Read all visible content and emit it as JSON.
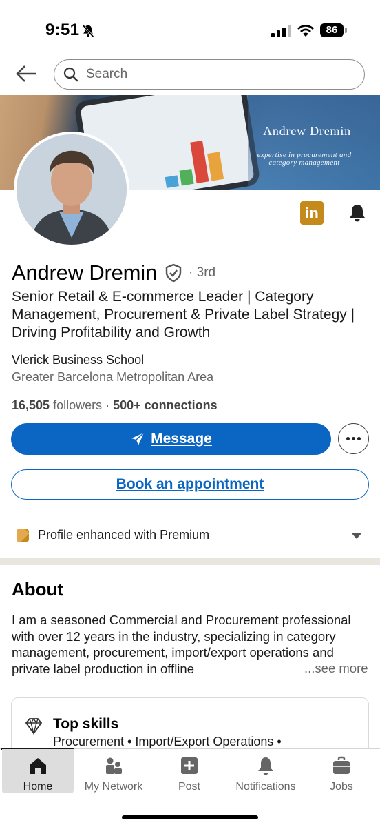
{
  "status_bar": {
    "time": "9:51",
    "battery": "86"
  },
  "search": {
    "placeholder": "Search"
  },
  "banner": {
    "name": "Andrew Dremin",
    "tagline_line1": "expertise in procurement and",
    "tagline_line2": "category management"
  },
  "profile": {
    "name": "Andrew Dremin",
    "degree": "· 3rd",
    "headline": "Senior Retail & E-commerce Leader | Category Management, Procurement & Private Label Strategy |  Driving Profitability and Growth",
    "school": "Vlerick Business School",
    "location": "Greater Barcelona Metropolitan Area",
    "followers_count": "16,505",
    "followers_label": " followers · ",
    "connections": "500+ connections"
  },
  "actions": {
    "message_label": "Message",
    "appointment_label": "Book an appointment",
    "linkedin_badge": "in"
  },
  "premium": {
    "label": "Profile enhanced with Premium"
  },
  "about": {
    "heading": "About",
    "text": "I am a seasoned Commercial and Procurement professional with over 12 years in the industry, specializing in category management, procurement, import/export operations and private label production in offline",
    "see_more": "...see more"
  },
  "skills": {
    "title": "Top skills",
    "list": "Procurement • Import/Export Operations •"
  },
  "tabs": [
    {
      "label": "Home",
      "icon": "home-icon",
      "active": true
    },
    {
      "label": "My Network",
      "icon": "network-icon",
      "active": false
    },
    {
      "label": "Post",
      "icon": "post-icon",
      "active": false
    },
    {
      "label": "Notifications",
      "icon": "notifications-icon",
      "active": false
    },
    {
      "label": "Jobs",
      "icon": "jobs-icon",
      "active": false
    }
  ],
  "colors": {
    "brand_blue": "#0a66c2",
    "premium_gold": "#c48a1c",
    "text_primary": "#191919",
    "text_secondary": "#666666"
  }
}
